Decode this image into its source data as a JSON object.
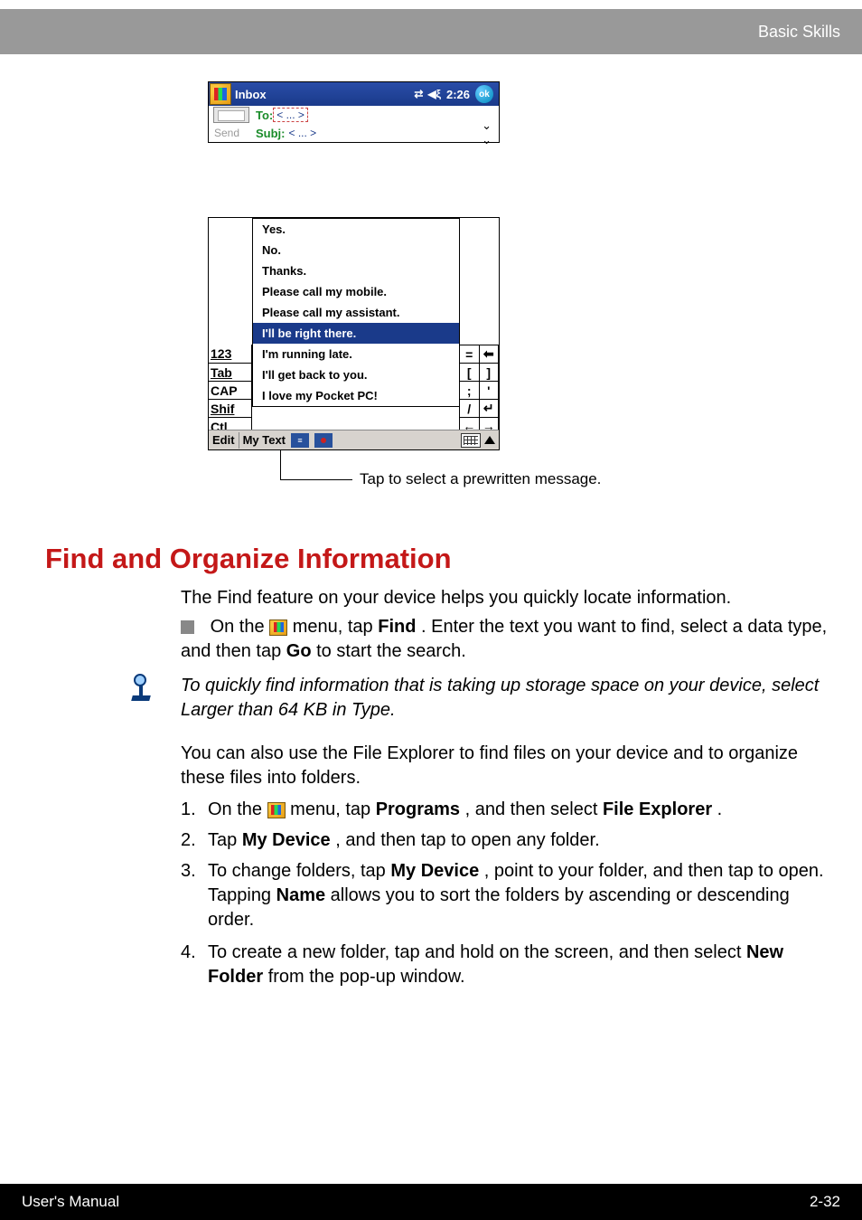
{
  "page_header": "Basic Skills",
  "footer_left": "User's Manual",
  "footer_right": "2-32",
  "screenshot1": {
    "title": "Inbox",
    "clock": "2:26",
    "ok": "ok",
    "to_label": "To:",
    "to_value": "< ... >",
    "send_label": "Send",
    "subj_label": "Subj:",
    "subj_value": "< ... >"
  },
  "screenshot2": {
    "popup_items": {
      "i0": "Yes.",
      "i1": "No.",
      "i2": "Thanks.",
      "i3": "Please call my mobile.",
      "i4": "Please call my assistant.",
      "i5": "I'll be right there.",
      "i6": "I'm running late.",
      "i7": "I'll get back to you.",
      "i8": "I love my Pocket PC!"
    },
    "kb_left": {
      "r0": "123",
      "r1": "Tab",
      "r2": "CAP",
      "r3": "Shif",
      "r4": "Ctl"
    },
    "kb_right": {
      "a0": "=",
      "a1": "⬅",
      "b0": "[",
      "b1": "]",
      "c0": ";",
      "c1": "'",
      "d0": "/",
      "d1": "↵",
      "e0": "←",
      "e1": "→"
    },
    "bottom": {
      "edit": "Edit",
      "mytext": "My Text"
    }
  },
  "callout": "Tap to select a prewritten message.",
  "section_title": "Find and Organize Information",
  "para1": "The Find feature on your device helps you quickly locate information.",
  "bullet1_a": "On the",
  "bullet1_b": " menu, tap ",
  "bullet1_bold1": "Find",
  "bullet1_c": ". Enter the text you want to find, select a data type, and then tap ",
  "bullet1_bold2": "Go",
  "bullet1_d": " to start the search.",
  "note": "To quickly find information that is taking up storage space on your device, select Larger than 64 KB in Type.",
  "para2": "You can also use the File Explorer to find files on your device and to organize these files into folders.",
  "ol": {
    "n1_a": "On the",
    "n1_b": " menu, tap ",
    "n1_bold1": "Programs",
    "n1_c": ", and then select ",
    "n1_bold2": "File Explorer",
    "n1_d": ".",
    "n2_a": "Tap ",
    "n2_bold1": "My Device",
    "n2_b": ", and then tap to open any folder.",
    "n3_a": "To change folders, tap ",
    "n3_bold1": "My Device",
    "n3_b": ", point to your folder, and then tap to open. Tapping ",
    "n3_bold2": "Name",
    "n3_c": " allows you to sort the folders by ascending or descending order.",
    "n4_a": "To create a new folder, tap and hold on the screen, and then select ",
    "n4_bold1": "New Folder",
    "n4_b": " from the pop-up window."
  },
  "num": {
    "n1": "1.",
    "n2": "2.",
    "n3": "3.",
    "n4": "4."
  }
}
